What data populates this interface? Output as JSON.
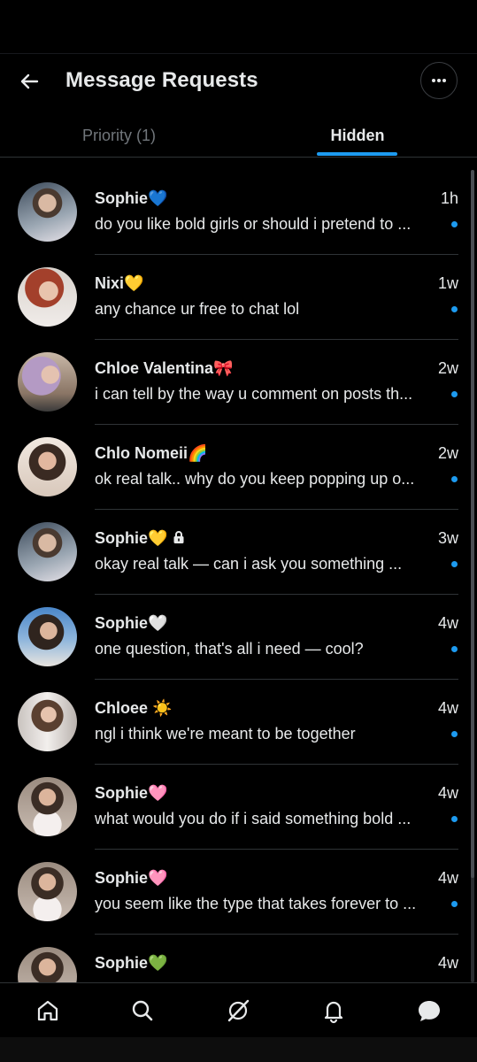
{
  "header": {
    "title": "Message Requests"
  },
  "tabs": [
    {
      "label": "Priority (1)",
      "active": false
    },
    {
      "label": "Hidden",
      "active": true
    }
  ],
  "colors": {
    "accent": "#1d9bf0",
    "background": "#000000",
    "text": "#e7e9ea",
    "muted": "#71767b"
  },
  "conversations": [
    {
      "name": "Sophie💙",
      "time": "1h",
      "preview": "do you like bold girls or should i pretend to ...",
      "unread": true,
      "locked": false
    },
    {
      "name": "Nixi💛",
      "time": "1w",
      "preview": "any chance ur free to chat lol",
      "unread": true,
      "locked": false
    },
    {
      "name": "Chloe Valentina🎀",
      "time": "2w",
      "preview": "i can tell by the way u comment on posts th...",
      "unread": true,
      "locked": false
    },
    {
      "name": "Chlo Nomeii🌈",
      "time": "2w",
      "preview": "ok real talk.. why do you keep popping up o...",
      "unread": true,
      "locked": false
    },
    {
      "name": "Sophie💛",
      "time": "3w",
      "preview": "okay real talk — can i ask you something ...",
      "unread": true,
      "locked": true
    },
    {
      "name": "Sophie🤍",
      "time": "4w",
      "preview": "one question, that's all i need — cool?",
      "unread": true,
      "locked": false
    },
    {
      "name": "Chloee ☀️",
      "time": "4w",
      "preview": "ngl i think we're meant to be together",
      "unread": true,
      "locked": false
    },
    {
      "name": "Sophie🩷",
      "time": "4w",
      "preview": "what would you do if i said something bold ...",
      "unread": true,
      "locked": false
    },
    {
      "name": "Sophie🩷",
      "time": "4w",
      "preview": "you seem like the type that takes forever to ...",
      "unread": true,
      "locked": false
    },
    {
      "name": "Sophie💚",
      "time": "4w",
      "preview": "",
      "unread": false,
      "locked": false
    }
  ],
  "bottom_nav": [
    "home-icon",
    "search-icon",
    "grok-icon",
    "notifications-icon",
    "messages-icon"
  ]
}
